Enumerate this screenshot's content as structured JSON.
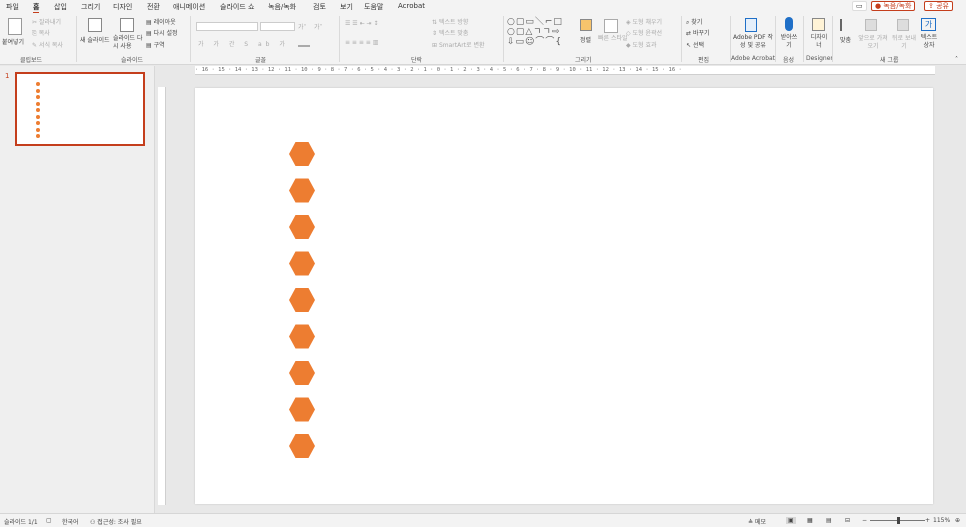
{
  "menubar": {
    "tabs": [
      "파일",
      "홈",
      "삽입",
      "그리기",
      "디자인",
      "전환",
      "애니메이션",
      "슬라이드 쇼",
      "녹음/녹화",
      "검토",
      "보기",
      "도움말",
      "Acrobat"
    ],
    "record_btn": "녹음/녹화",
    "share_btn": "공유"
  },
  "ribbon": {
    "clipboard": {
      "paste": "붙여넣기",
      "cut": "잘라내기",
      "copy": "복사",
      "format_painter": "서식 복사",
      "label": "클립보드"
    },
    "slides": {
      "new_slide": "새 슬라이드",
      "reuse": "슬라이드 다시 사용",
      "layout": "레이아웃",
      "reset": "다시 설정",
      "section": "구역",
      "label": "슬라이드"
    },
    "font": {
      "label": "글꼴",
      "bold": "가",
      "grow": "가˄",
      "shrink": "가˅"
    },
    "paragraph": {
      "text_direction": "텍스트 방향",
      "align_text": "텍스트 맞춤",
      "smartart": "SmartArt로 변환",
      "label": "단락"
    },
    "drawing": {
      "arrange": "정렬",
      "quick_styles": "빠른 스타일",
      "fill": "도형 채우기",
      "outline": "도형 윤곽선",
      "effects": "도형 효과",
      "label": "그리기"
    },
    "editing": {
      "find": "찾기",
      "replace": "바꾸기",
      "select": "선택",
      "label": "편집"
    },
    "adobe": {
      "create_pdf": "Adobe PDF 작성 및 공유",
      "label": "Adobe Acrobat"
    },
    "voice": {
      "dictate": "받아쓰기",
      "label": "음성"
    },
    "designer": {
      "btn": "디자이너",
      "label": "Designer"
    },
    "newgroup": {
      "align": "맞춤",
      "bring_forward": "앞으로 가져오기",
      "send_backward": "뒤로 보내기",
      "textbox": "텍스트 상자",
      "label": "새 그룹"
    }
  },
  "ruler": {
    "h_text": "· 16 · 15 · 14 · 13 · 12 · 11 · 10 · 9 · 8 · 7 · 6 · 5 · 4 · 3 · 2 · 1 · 0 · 1 · 2 · 3 · 4 · 5 · 6 · 7 · 8 · 9 · 10 · 11 · 12 · 13 · 14 · 15 · 16 ·"
  },
  "slides_pane": {
    "slide_number": "1"
  },
  "slide": {
    "shape": "hexagon",
    "shape_color": "#ed7d31",
    "shape_count": 9
  },
  "statusbar": {
    "slide_info": "슬라이드 1/1",
    "language": "한국어",
    "accessibility": "접근성: 조사 필요",
    "notes": "메모",
    "zoom": "115%"
  },
  "colors": {
    "accent": "#c43e1c",
    "shape": "#ed7d31"
  }
}
